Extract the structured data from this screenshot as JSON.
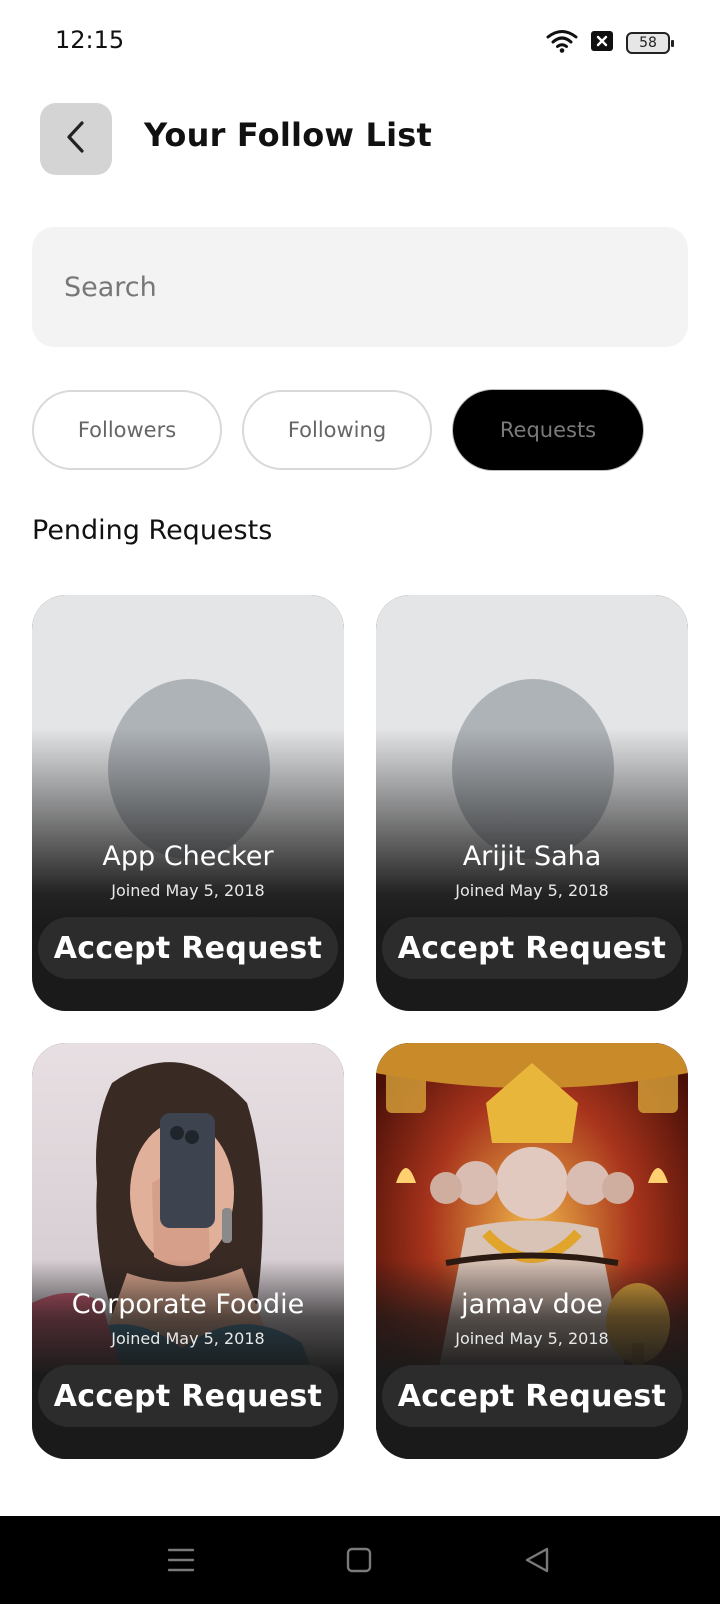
{
  "status_bar": {
    "time": "12:15",
    "battery": "58"
  },
  "header": {
    "title": "Your Follow List"
  },
  "search": {
    "placeholder": "Search"
  },
  "tabs": [
    {
      "label": "Followers",
      "active": false
    },
    {
      "label": "Following",
      "active": false
    },
    {
      "label": "Requests",
      "active": true
    }
  ],
  "section_title": "Pending Requests",
  "requests": [
    {
      "name": "App Checker",
      "joined": "Joined May 5, 2018",
      "action": "Accept Request",
      "avatar": "placeholder"
    },
    {
      "name": "Arijit Saha",
      "joined": "Joined May 5, 2018",
      "action": "Accept Request",
      "avatar": "placeholder"
    },
    {
      "name": "Corporate Foodie",
      "joined": "Joined May 5, 2018",
      "action": "Accept Request",
      "avatar": "photo-woman-with-phone"
    },
    {
      "name": "jamav doe",
      "joined": "Joined May 5, 2018",
      "action": "Accept Request",
      "avatar": "photo-deity-artwork"
    }
  ],
  "nav": {
    "icons": [
      "menu-icon",
      "home-square-icon",
      "back-triangle-icon"
    ]
  },
  "colors": {
    "accent": "#000000",
    "card_bg": "#1a1a1a",
    "button_bg": "#2c2c2c",
    "search_bg": "#f3f3f3"
  }
}
